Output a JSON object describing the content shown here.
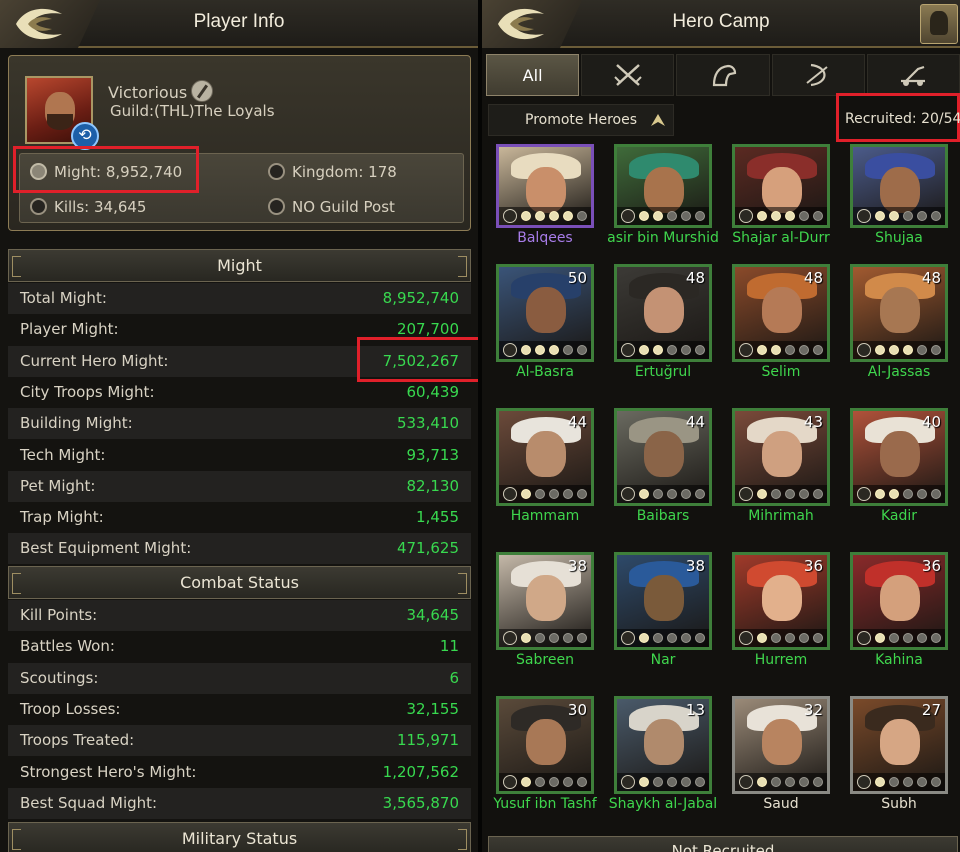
{
  "left": {
    "title": "Player Info",
    "player": {
      "name": "Victorious",
      "guild": "Guild:(THL)The Loyals",
      "might_label": "Might: 8,952,740",
      "kingdom_label": "Kingdom: 178",
      "kills_label": "Kills: 34,645",
      "guild_post": "NO Guild Post"
    },
    "might_section": {
      "header": "Might",
      "rows": [
        {
          "label": "Total Might:",
          "value": "8,952,740"
        },
        {
          "label": "Player Might:",
          "value": "207,700"
        },
        {
          "label": "Current Hero Might:",
          "value": "7,502,267"
        },
        {
          "label": "City Troops Might:",
          "value": "60,439"
        },
        {
          "label": "Building Might:",
          "value": "533,410"
        },
        {
          "label": "Tech Might:",
          "value": "93,713"
        },
        {
          "label": "Pet Might:",
          "value": "82,130"
        },
        {
          "label": "Trap Might:",
          "value": "1,455"
        },
        {
          "label": "Best Equipment Might:",
          "value": "471,625"
        }
      ]
    },
    "combat_section": {
      "header": "Combat Status",
      "rows": [
        {
          "label": "Kill Points:",
          "value": "34,645"
        },
        {
          "label": "Battles Won:",
          "value": "11"
        },
        {
          "label": "Scoutings:",
          "value": "6"
        },
        {
          "label": "Troop Losses:",
          "value": "32,155"
        },
        {
          "label": "Troops Treated:",
          "value": "115,971"
        },
        {
          "label": "Strongest Hero's Might:",
          "value": "1,207,562"
        },
        {
          "label": "Best Squad Might:",
          "value": "3,565,870"
        }
      ]
    },
    "military_header": "Military Status"
  },
  "right": {
    "title": "Hero Camp",
    "tabs": [
      {
        "label": "All",
        "icon": "all"
      },
      {
        "label": "",
        "icon": "crossed-swords-icon"
      },
      {
        "label": "",
        "icon": "horse-head-icon"
      },
      {
        "label": "",
        "icon": "bow-icon"
      },
      {
        "label": "",
        "icon": "siege-catapult-icon"
      }
    ],
    "promote_label": "Promote Heroes",
    "recruited_label": "Recruited: 20/54",
    "not_recruited_label": "Not Recruited",
    "heroes": [
      {
        "name": "Balqees",
        "level": "",
        "stars": 4,
        "rarity": "purple",
        "palette": [
          "#c9b79a",
          "#e8dcc0",
          "#c98f6a"
        ]
      },
      {
        "name": "asir bin Murshid",
        "level": "",
        "stars": 2,
        "rarity": "green",
        "palette": [
          "#3f6b3a",
          "#2f8a6e",
          "#a8734c"
        ]
      },
      {
        "name": "Shajar al-Durr",
        "level": "",
        "stars": 3,
        "rarity": "green",
        "palette": [
          "#5b2a22",
          "#8a2e2a",
          "#d6a07c"
        ]
      },
      {
        "name": "Shujaa",
        "level": "",
        "stars": 2,
        "rarity": "green",
        "palette": [
          "#4b5b8a",
          "#3a4ea0",
          "#9e6c4a"
        ]
      },
      {
        "name": "Al-Basra",
        "level": "50",
        "stars": 3,
        "rarity": "green",
        "palette": [
          "#3a5478",
          "#27406a",
          "#8a5c40"
        ]
      },
      {
        "name": "Ertuğrul",
        "level": "48",
        "stars": 2,
        "rarity": "green",
        "palette": [
          "#3c3a36",
          "#2b2824",
          "#c49274"
        ]
      },
      {
        "name": "Selim",
        "level": "48",
        "stars": 2,
        "rarity": "green",
        "palette": [
          "#8a4a2a",
          "#c06b30",
          "#b57a56"
        ]
      },
      {
        "name": "Al-Jassas",
        "level": "48",
        "stars": 3,
        "rarity": "green",
        "palette": [
          "#a15a30",
          "#d18a4a",
          "#a77752"
        ]
      },
      {
        "name": "Hammam",
        "level": "44",
        "stars": 1,
        "rarity": "green",
        "palette": [
          "#6b4a3a",
          "#e8e4dc",
          "#b88c6c"
        ]
      },
      {
        "name": "Baibars",
        "level": "44",
        "stars": 1,
        "rarity": "green",
        "palette": [
          "#6a6a60",
          "#9a9584",
          "#8a6448"
        ]
      },
      {
        "name": "Mihrimah",
        "level": "43",
        "stars": 1,
        "rarity": "green",
        "palette": [
          "#7a4a3a",
          "#e4d8c8",
          "#cfa080"
        ]
      },
      {
        "name": "Kadir",
        "level": "40",
        "stars": 2,
        "rarity": "green",
        "palette": [
          "#b0523a",
          "#e9e2d6",
          "#9a6a4c"
        ]
      },
      {
        "name": "Sabreen",
        "level": "38",
        "stars": 1,
        "rarity": "green",
        "palette": [
          "#c4b8a8",
          "#e6e0d6",
          "#d0a888"
        ]
      },
      {
        "name": "Nar",
        "level": "38",
        "stars": 1,
        "rarity": "green",
        "palette": [
          "#2e4a6a",
          "#2a5a9a",
          "#7a5a3a"
        ]
      },
      {
        "name": "Hurrem",
        "level": "36",
        "stars": 1,
        "rarity": "green",
        "palette": [
          "#a03a2a",
          "#d04a30",
          "#e2b08c"
        ]
      },
      {
        "name": "Kahina",
        "level": "36",
        "stars": 1,
        "rarity": "green",
        "palette": [
          "#8a2a2a",
          "#c0302a",
          "#d4a07c"
        ]
      },
      {
        "name": "Yusuf ibn Tashf",
        "level": "30",
        "stars": 1,
        "rarity": "green",
        "palette": [
          "#5a4a3a",
          "#2e2a26",
          "#a87856"
        ]
      },
      {
        "name": "Shaykh al-Jabal",
        "level": "13",
        "stars": 1,
        "rarity": "green",
        "palette": [
          "#4a5a6a",
          "#d8d4ca",
          "#b08a6c"
        ]
      },
      {
        "name": "Saud",
        "level": "32",
        "stars": 1,
        "rarity": "gray",
        "palette": [
          "#9a8a78",
          "#e8e2d8",
          "#b88460"
        ]
      },
      {
        "name": "Subh",
        "level": "27",
        "stars": 1,
        "rarity": "gray",
        "palette": [
          "#7a4a2a",
          "#3a2a1e",
          "#d6a684"
        ]
      }
    ]
  }
}
